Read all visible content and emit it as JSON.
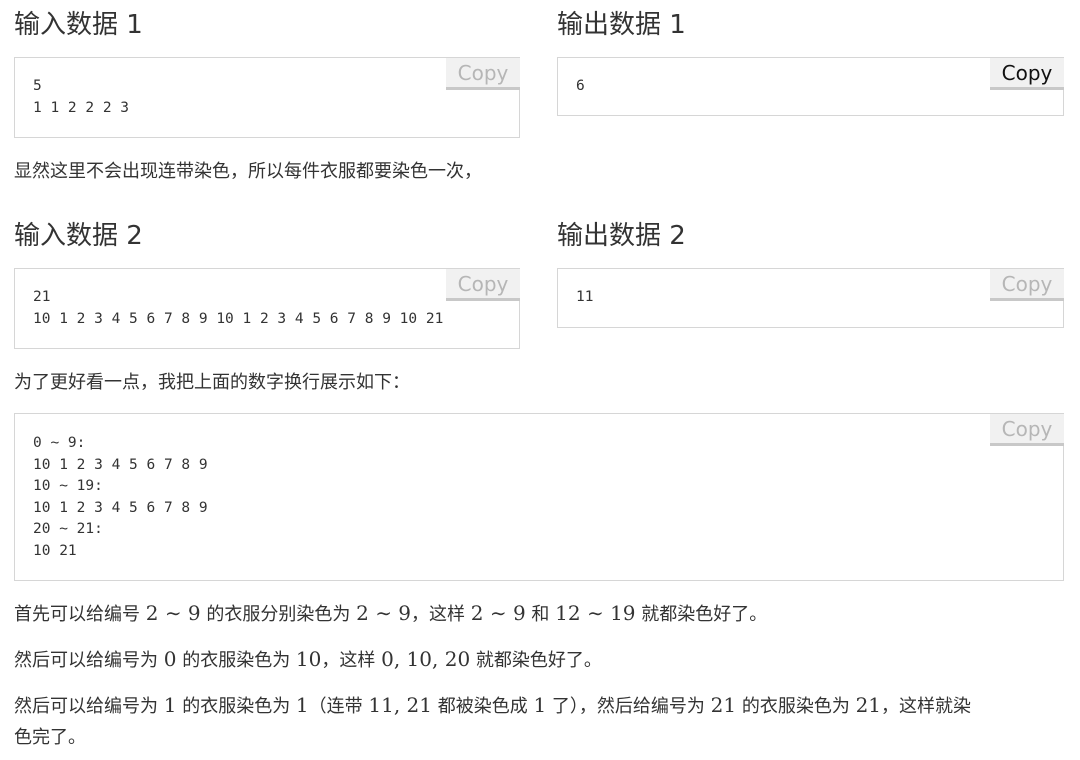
{
  "sample1": {
    "input_title": "输入数据 1",
    "input_text": "5\n1 1 2 2 2 3",
    "output_title": "输出数据 1",
    "output_text": "6"
  },
  "note1": "显然这里不会出现连带染色，所以每件衣服都要染色一次，",
  "sample2": {
    "input_title": "输入数据 2",
    "input_text": "21\n10 1 2 3 4 5 6 7 8 9 10 1 2 3 4 5 6 7 8 9 10 21",
    "output_title": "输出数据 2",
    "output_text": "11"
  },
  "note2": "为了更好看一点，我把上面的数字换行展示如下：",
  "code_block": "0 ~ 9:\n10 1 2 3 4 5 6 7 8 9\n10 ~ 19:\n10 1 2 3 4 5 6 7 8 9\n20 ~ 21:\n10 21",
  "copy_label": "Copy",
  "explain": {
    "line1": {
      "t1": "首先可以给编号 ",
      "m1": "2 ∼ 9",
      "t2": " 的衣服分别染色为 ",
      "m2": "2 ∼ 9",
      "t3": "，这样 ",
      "m3": "2 ∼ 9",
      "t4": " 和 ",
      "m4": "12 ∼ 19",
      "t5": " 就都染色好了。"
    },
    "line2": {
      "t1": "然后可以给编号为 ",
      "m1": "0",
      "t2": " 的衣服染色为 ",
      "m2": "10",
      "t3": "，这样 ",
      "m3": "0, 10, 20",
      "t4": " 就都染色好了。"
    },
    "line3": {
      "t1": "然后可以给编号为 ",
      "m1": "1",
      "t2": " 的衣服染色为 ",
      "m2": "1",
      "t3": "（连带 ",
      "m3": "11, 21",
      "t4": " 都被染色成 ",
      "m4": "1",
      "t5": " 了），然后给编号为 ",
      "m5": "21",
      "t6": " 的衣服染色为 ",
      "m6": "21",
      "t7": "，这样就染",
      "t8": "色完了。"
    }
  }
}
